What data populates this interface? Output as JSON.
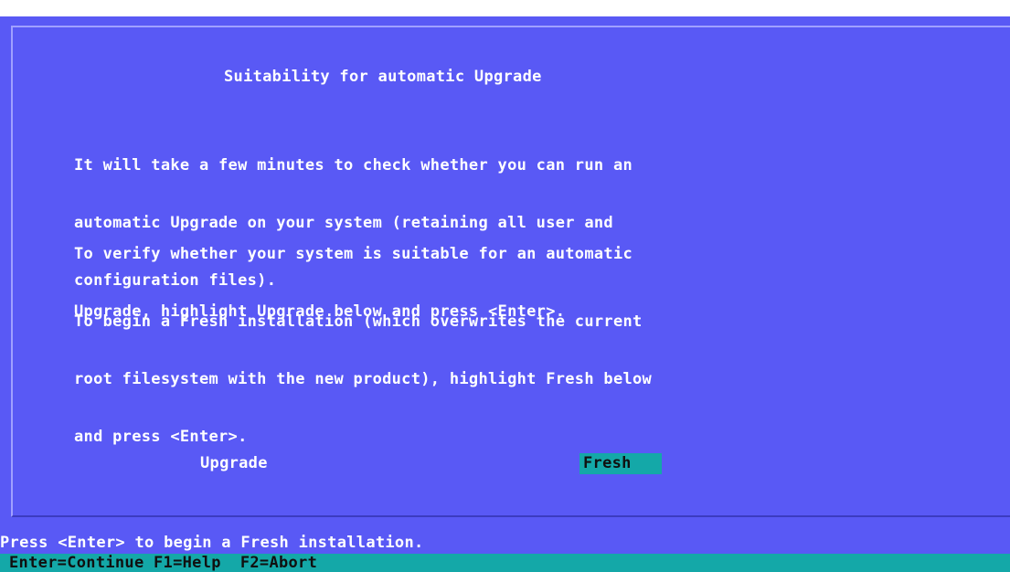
{
  "dialog": {
    "title": "Suitability for automatic Upgrade",
    "paragraphs": [
      {
        "lines": [
          "It will take a few minutes to check whether you can run an",
          "automatic Upgrade on your system (retaining all user and",
          "configuration files)."
        ]
      },
      {
        "lines": [
          "To verify whether your system is suitable for an automatic",
          "Upgrade, highlight Upgrade below and press <Enter>."
        ]
      },
      {
        "lines": [
          "To begin a Fresh installation (which overwrites the current",
          "root filesystem with the new product), highlight Fresh below",
          "and press <Enter>."
        ]
      }
    ],
    "buttons": {
      "upgrade_label": "Upgrade",
      "fresh_label": "Fresh",
      "selected": "Fresh"
    }
  },
  "status_line": "Press <Enter> to begin a Fresh installation.",
  "key_bar": "Enter=Continue F1=Help  F2=Abort",
  "colors": {
    "screen_background": "#5959f5",
    "highlight": "#14a8a8",
    "text": "#ffffff",
    "highlight_text": "#101010"
  }
}
